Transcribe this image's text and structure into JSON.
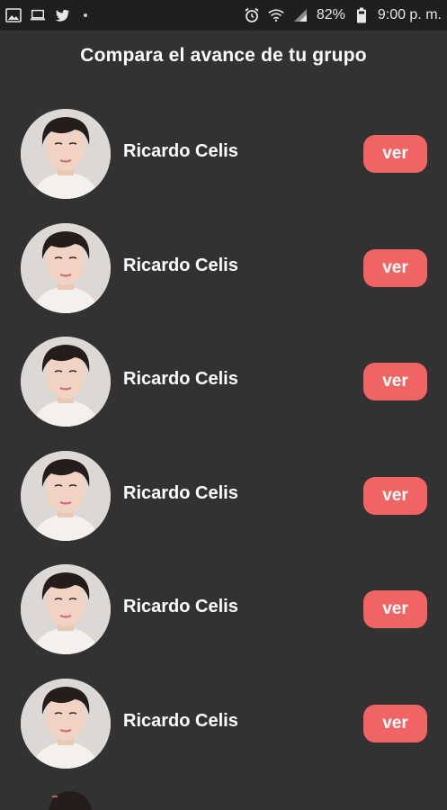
{
  "status_bar": {
    "battery": "82%",
    "time": "9:00 p. m."
  },
  "page_title": "Compara el avance de tu grupo",
  "members": [
    {
      "name": "Ricardo Celis",
      "button_label": "ver"
    },
    {
      "name": "Ricardo Celis",
      "button_label": "ver"
    },
    {
      "name": "Ricardo Celis",
      "button_label": "ver"
    },
    {
      "name": "Ricardo Celis",
      "button_label": "ver"
    },
    {
      "name": "Ricardo Celis",
      "button_label": "ver"
    },
    {
      "name": "Ricardo Celis",
      "button_label": "ver"
    }
  ],
  "colors": {
    "background": "#323232",
    "status_bar": "#1f1f1f",
    "button": "#f06464",
    "text": "#ffffff"
  }
}
